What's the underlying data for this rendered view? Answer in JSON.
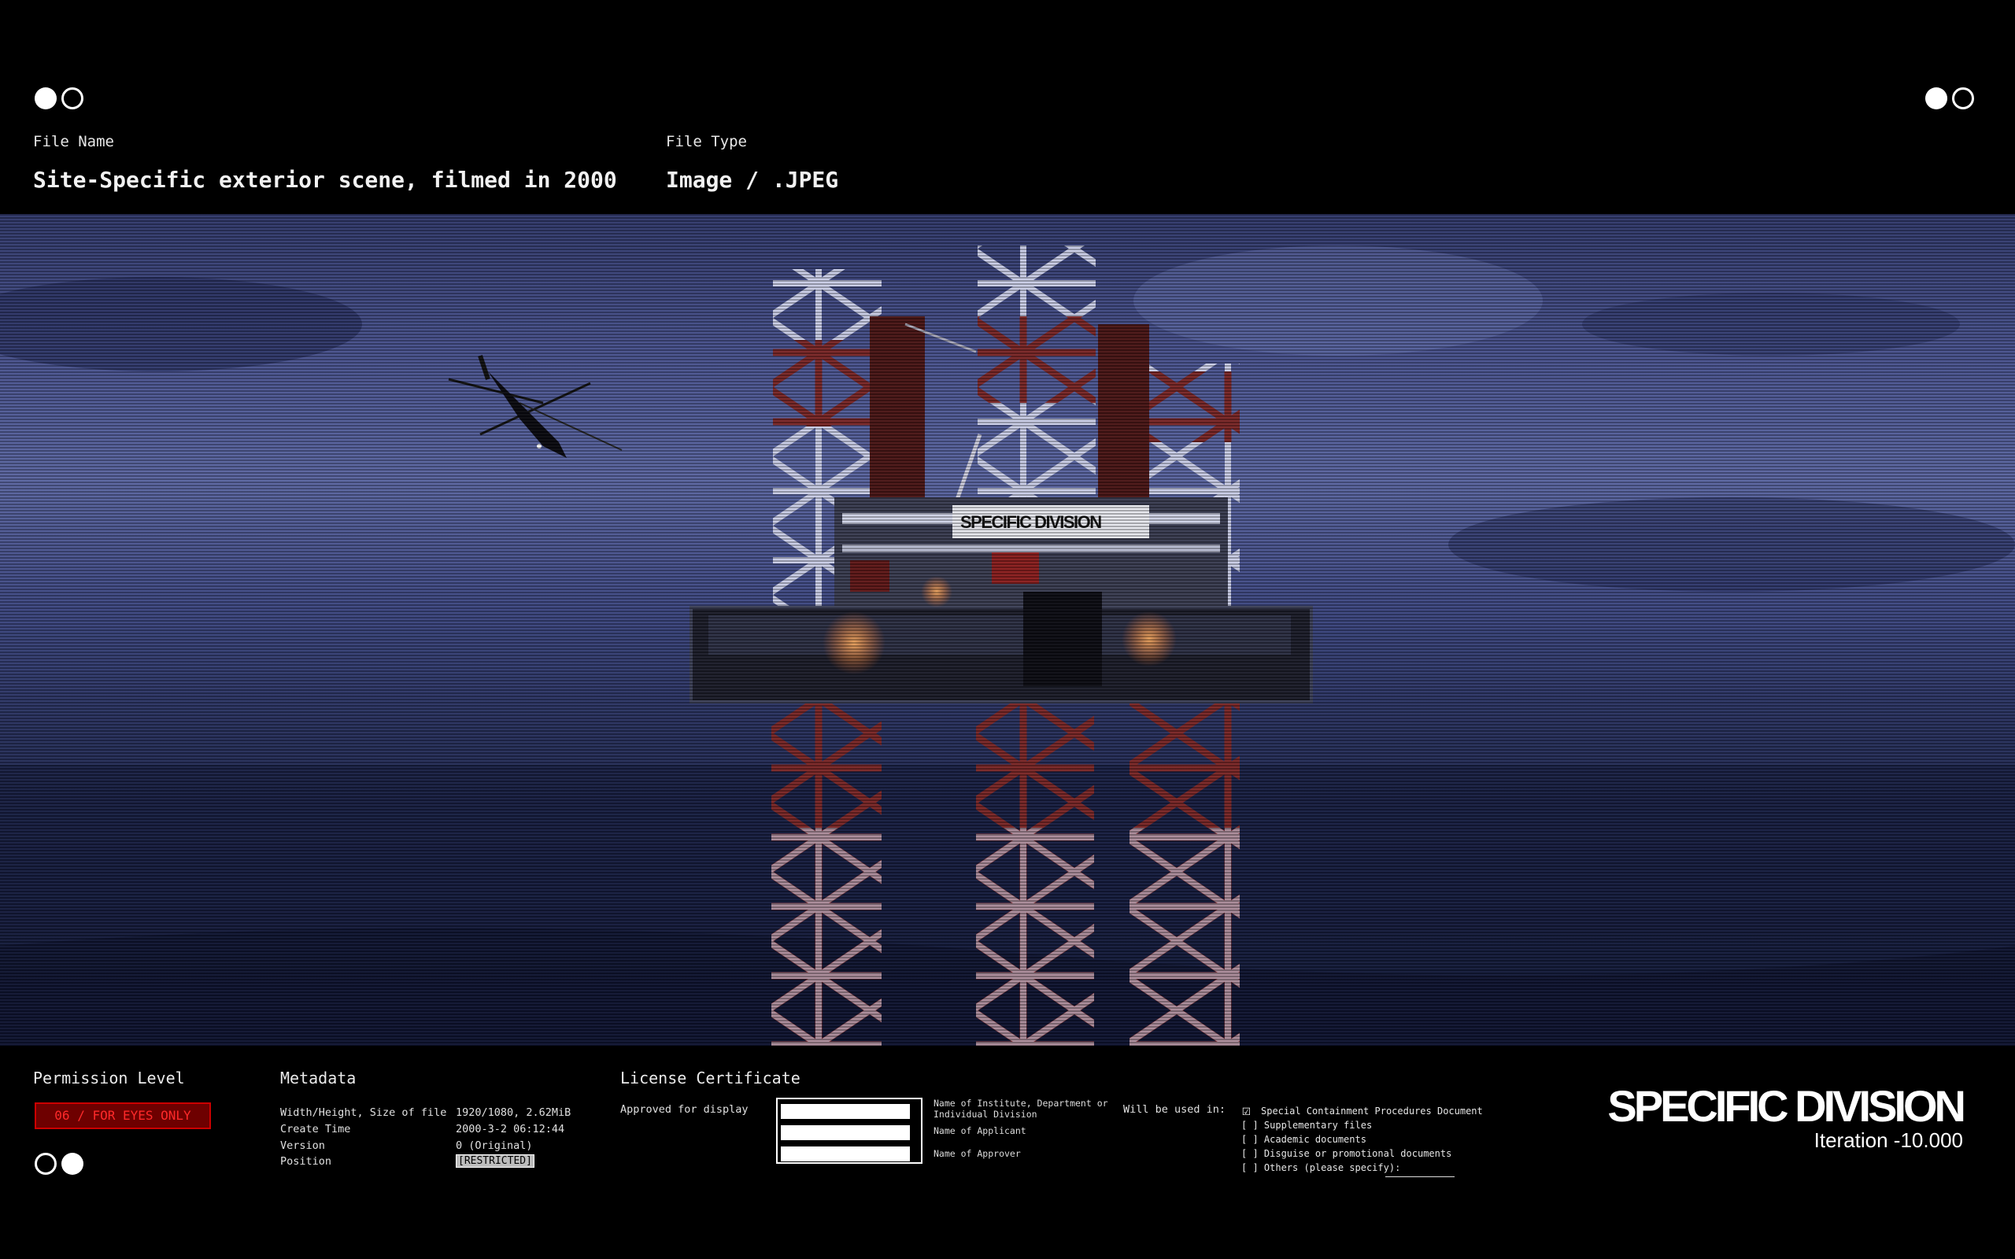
{
  "header": {
    "file_name_label": "File Name",
    "file_name_value": "Site-Specific exterior scene, filmed in 2000",
    "file_type_label": "File Type",
    "file_type_value": "Image / .JPEG"
  },
  "scene": {
    "platform_sign": "SPECIFIC DIVISION"
  },
  "permission": {
    "title": "Permission Level",
    "badge": "06 / FOR EYES ONLY"
  },
  "metadata": {
    "title": "Metadata",
    "rows": [
      {
        "key": "Width/Height, Size of file",
        "value": "1920/1080, 2.62MiB"
      },
      {
        "key": "Create Time",
        "value": "2000-3-2 06:12:44"
      },
      {
        "key": "Version",
        "value": "0 (Original)"
      },
      {
        "key": "Position",
        "value": "[RESTRICTED]"
      }
    ]
  },
  "license": {
    "title": "License Certificate",
    "approved": "Approved for display",
    "fields": [
      "Name of Institute, Department or Individual Division",
      "Name of Applicant",
      "Name of Approver"
    ],
    "used_in_label": "Will be used in:",
    "options": [
      "Special Containment Procedures Document",
      "[ ] Supplementary files",
      "[ ] Academic documents",
      "[ ] Disguise or promotional documents",
      "[ ] Others (please specify):"
    ]
  },
  "brand": {
    "name": "SPECIFIC DIVISION",
    "iteration": "Iteration -10.000"
  }
}
